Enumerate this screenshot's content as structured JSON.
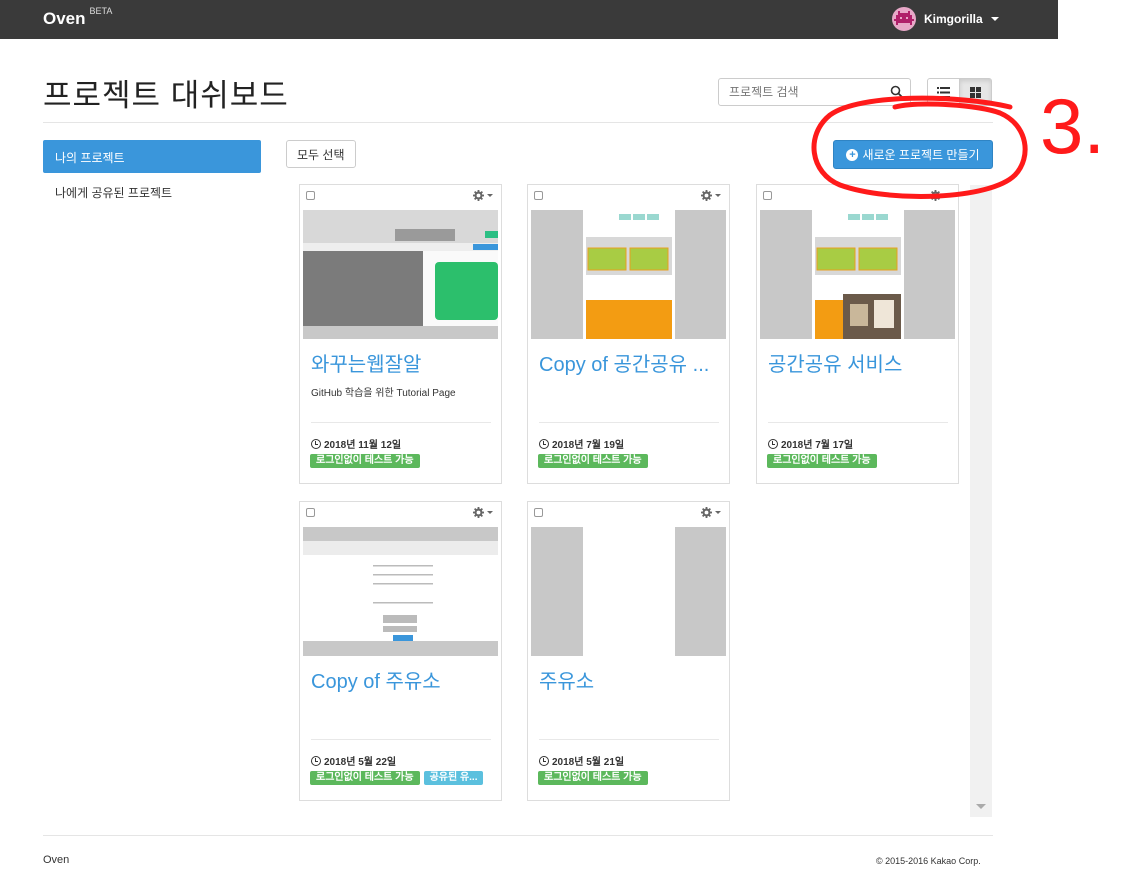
{
  "navbar": {
    "brand": "Oven",
    "brand_sup": "BETA",
    "user_name": "Kimgorilla"
  },
  "header": {
    "title": "프로젝트 대쉬보드",
    "search_placeholder": "프로젝트 검색"
  },
  "sidebar": {
    "items": [
      {
        "label": "나의 프로젝트",
        "active": true
      },
      {
        "label": "나에게 공유된 프로젝트",
        "active": false
      }
    ]
  },
  "toolbar": {
    "select_all": "모두 선택",
    "new_project": "새로운 프로젝트 만들기"
  },
  "projects": [
    {
      "title": "와꾸는웹잘알",
      "desc": "GitHub 학습을 위한 Tutorial Page",
      "date": "2018년 11월 12일",
      "badges": [
        "로그인없이 테스트 가능"
      ]
    },
    {
      "title": "Copy of 공간공유 ...",
      "desc": "",
      "date": "2018년 7월 19일",
      "badges": [
        "로그인없이 테스트 가능"
      ]
    },
    {
      "title": "공간공유 서비스",
      "desc": "",
      "date": "2018년 7월 17일",
      "badges": [
        "로그인없이 테스트 가능"
      ]
    },
    {
      "title": "Copy of 주유소",
      "desc": "",
      "date": "2018년 5월 22일",
      "badges": [
        "로그인없이 테스트 가능",
        "공유된 유..."
      ]
    },
    {
      "title": "주유소",
      "desc": "",
      "date": "2018년 5월 21일",
      "badges": [
        "로그인없이 테스트 가능"
      ]
    }
  ],
  "footer": {
    "left": "Oven",
    "right": "© 2015-2016 Kakao Corp."
  },
  "annotation": {
    "text": "3.",
    "color": "#ff1a1a"
  },
  "colors": {
    "navbar": "#3a3a3a",
    "primary": "#3a96db",
    "badge_green": "#5cb85c",
    "badge_blue": "#5bc0de"
  }
}
